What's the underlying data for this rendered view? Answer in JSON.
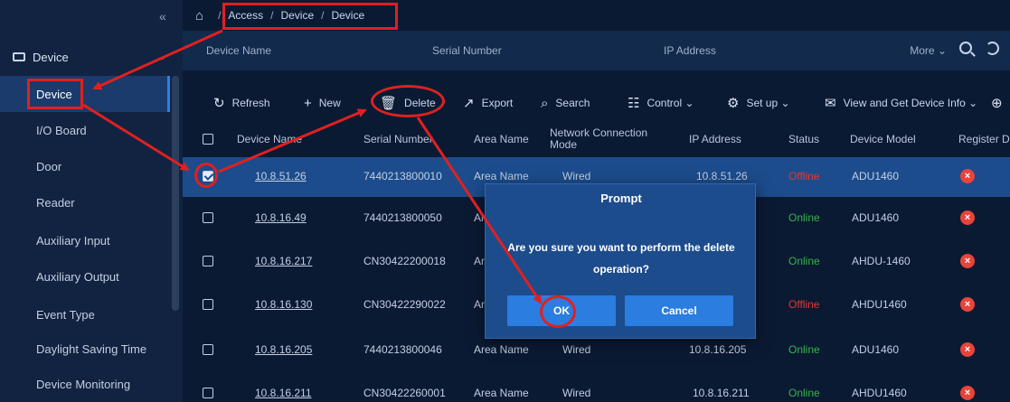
{
  "sidebar": {
    "collapse_glyph": "«",
    "group_label": "Device",
    "group_chevron": "⌄",
    "items": [
      {
        "label": "Device",
        "active": true
      },
      {
        "label": "I/O Board"
      },
      {
        "label": "Door"
      },
      {
        "label": "Reader"
      },
      {
        "label": "Auxiliary Input"
      },
      {
        "label": "Auxiliary Output"
      },
      {
        "label": "Event Type"
      },
      {
        "label": "Daylight Saving Time"
      },
      {
        "label": "Device Monitoring"
      }
    ]
  },
  "breadcrumb": {
    "home_icon": "home-icon",
    "items": [
      "Access",
      "Device",
      "Device"
    ],
    "separator": "/"
  },
  "filter": {
    "device_name": "Device Name",
    "serial_number": "Serial Number",
    "ip_address": "IP Address",
    "more": "More ⌄"
  },
  "toolbar": {
    "refresh": "Refresh",
    "new": "New",
    "delete": "Delete",
    "export": "Export",
    "search": "Search",
    "control": "Control ⌄",
    "setup": "Set up ⌄",
    "view": "View and Get Device Info ⌄"
  },
  "table": {
    "headers": [
      "Device Name",
      "Serial Number",
      "Area Name",
      "Network Connection Mode",
      "IP Address",
      "Status",
      "Device Model",
      "Register D"
    ],
    "rows": [
      {
        "name": "10.8.51.26",
        "serial": "7440213800010",
        "area": "Area Name",
        "mode": "Wired",
        "ip": "10.8.51.26",
        "status": "Offline",
        "model": "ADU1460",
        "checked": true
      },
      {
        "name": "10.8.16.49",
        "serial": "7440213800050",
        "area": "Ar",
        "mode": "",
        "ip": "",
        "status": "Online",
        "model": "ADU1460"
      },
      {
        "name": "10.8.16.217",
        "serial": "CN30422200018",
        "area": "Ar",
        "mode": "",
        "ip": "",
        "status": "Online",
        "model": "AHDU-1460"
      },
      {
        "name": "10.8.16.130",
        "serial": "CN30422290022",
        "area": "Ar",
        "mode": "",
        "ip": "",
        "status": "Offline",
        "model": "AHDU1460"
      },
      {
        "name": "10.8.16.205",
        "serial": "7440213800046",
        "area": "Area Name",
        "mode": "Wired",
        "ip": "10.8.16.205",
        "status": "Online",
        "model": "ADU1460"
      },
      {
        "name": "10.8.16.211",
        "serial": "CN30422260001",
        "area": "Area Name",
        "mode": "Wired",
        "ip": "10.8.16.211",
        "status": "Online",
        "model": "AHDU1460"
      }
    ]
  },
  "modal": {
    "title": "Prompt",
    "message": "Are you sure you want to perform the delete operation?",
    "ok": "OK",
    "cancel": "Cancel"
  },
  "colors": {
    "accent": "#2b7de0",
    "annotation": "#e02020",
    "online": "#38b34a",
    "offline": "#e03a2f"
  }
}
